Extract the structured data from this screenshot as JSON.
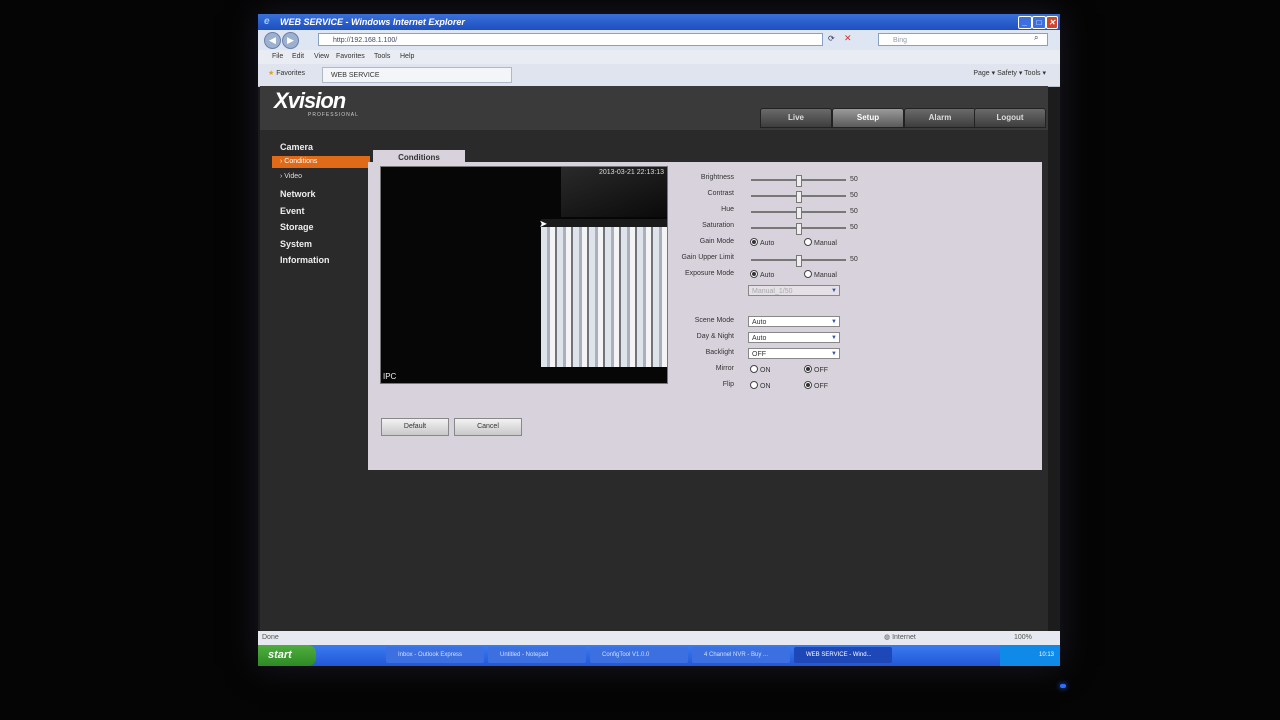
{
  "browser": {
    "title": "WEB SERVICE - Windows Internet Explorer",
    "address": "http://192.168.1.100/",
    "search_placeholder": "Bing",
    "menu": [
      "File",
      "Edit",
      "View",
      "Favorites",
      "Tools",
      "Help"
    ],
    "favorites_label": "Favorites",
    "tab_label": "WEB SERVICE",
    "toolbar_tools": "Page ▾  Safety ▾  Tools ▾",
    "status_left": "Done",
    "status_zone": "Internet",
    "zoom": "100%"
  },
  "app": {
    "logo": "Xvision",
    "logo_sub": "PROFESSIONAL",
    "nav": [
      "Live",
      "Setup",
      "Alarm",
      "Logout"
    ],
    "active_nav": "Setup"
  },
  "sidebar": {
    "camera": "Camera",
    "conditions": "Conditions",
    "video": "Video",
    "network": "Network",
    "event": "Event",
    "storage": "Storage",
    "system": "System",
    "information": "Information"
  },
  "panel": {
    "tab": "Conditions",
    "timestamp": "2013-03-21 22:13:13",
    "overlay": "IPC",
    "brightness_label": "Brightness",
    "brightness": 50,
    "contrast_label": "Contrast",
    "contrast": 50,
    "hue_label": "Hue",
    "hue": 50,
    "saturation_label": "Saturation",
    "saturation": 50,
    "gain_mode_label": "Gain Mode",
    "auto": "Auto",
    "manual": "Manual",
    "gain_upper_label": "Gain Upper Limit",
    "gain_upper": 50,
    "exposure_label": "Exposure Mode",
    "exposure_value": "Manual_1/50",
    "scene_label": "Scene Mode",
    "scene_value": "Auto",
    "daynight_label": "Day & Night",
    "daynight_value": "Auto",
    "backlight_label": "Backlight",
    "backlight_value": "OFF",
    "mirror_label": "Mirror",
    "flip_label": "Flip",
    "on": "ON",
    "off": "OFF",
    "default_btn": "Default",
    "cancel_btn": "Cancel"
  },
  "taskbar": {
    "start": "start",
    "tasks": [
      "Inbox - Outlook Express",
      "Untitled - Notepad",
      "ConfigTool V1.0.0",
      "4 Channel NVR - Buy ...",
      "WEB SERVICE - Wind..."
    ],
    "clock": "10:13"
  },
  "colors": {
    "accent_orange": "#e06a18",
    "ie_blue": "#1d4fc0",
    "panel_bg": "#d8d2dc"
  }
}
